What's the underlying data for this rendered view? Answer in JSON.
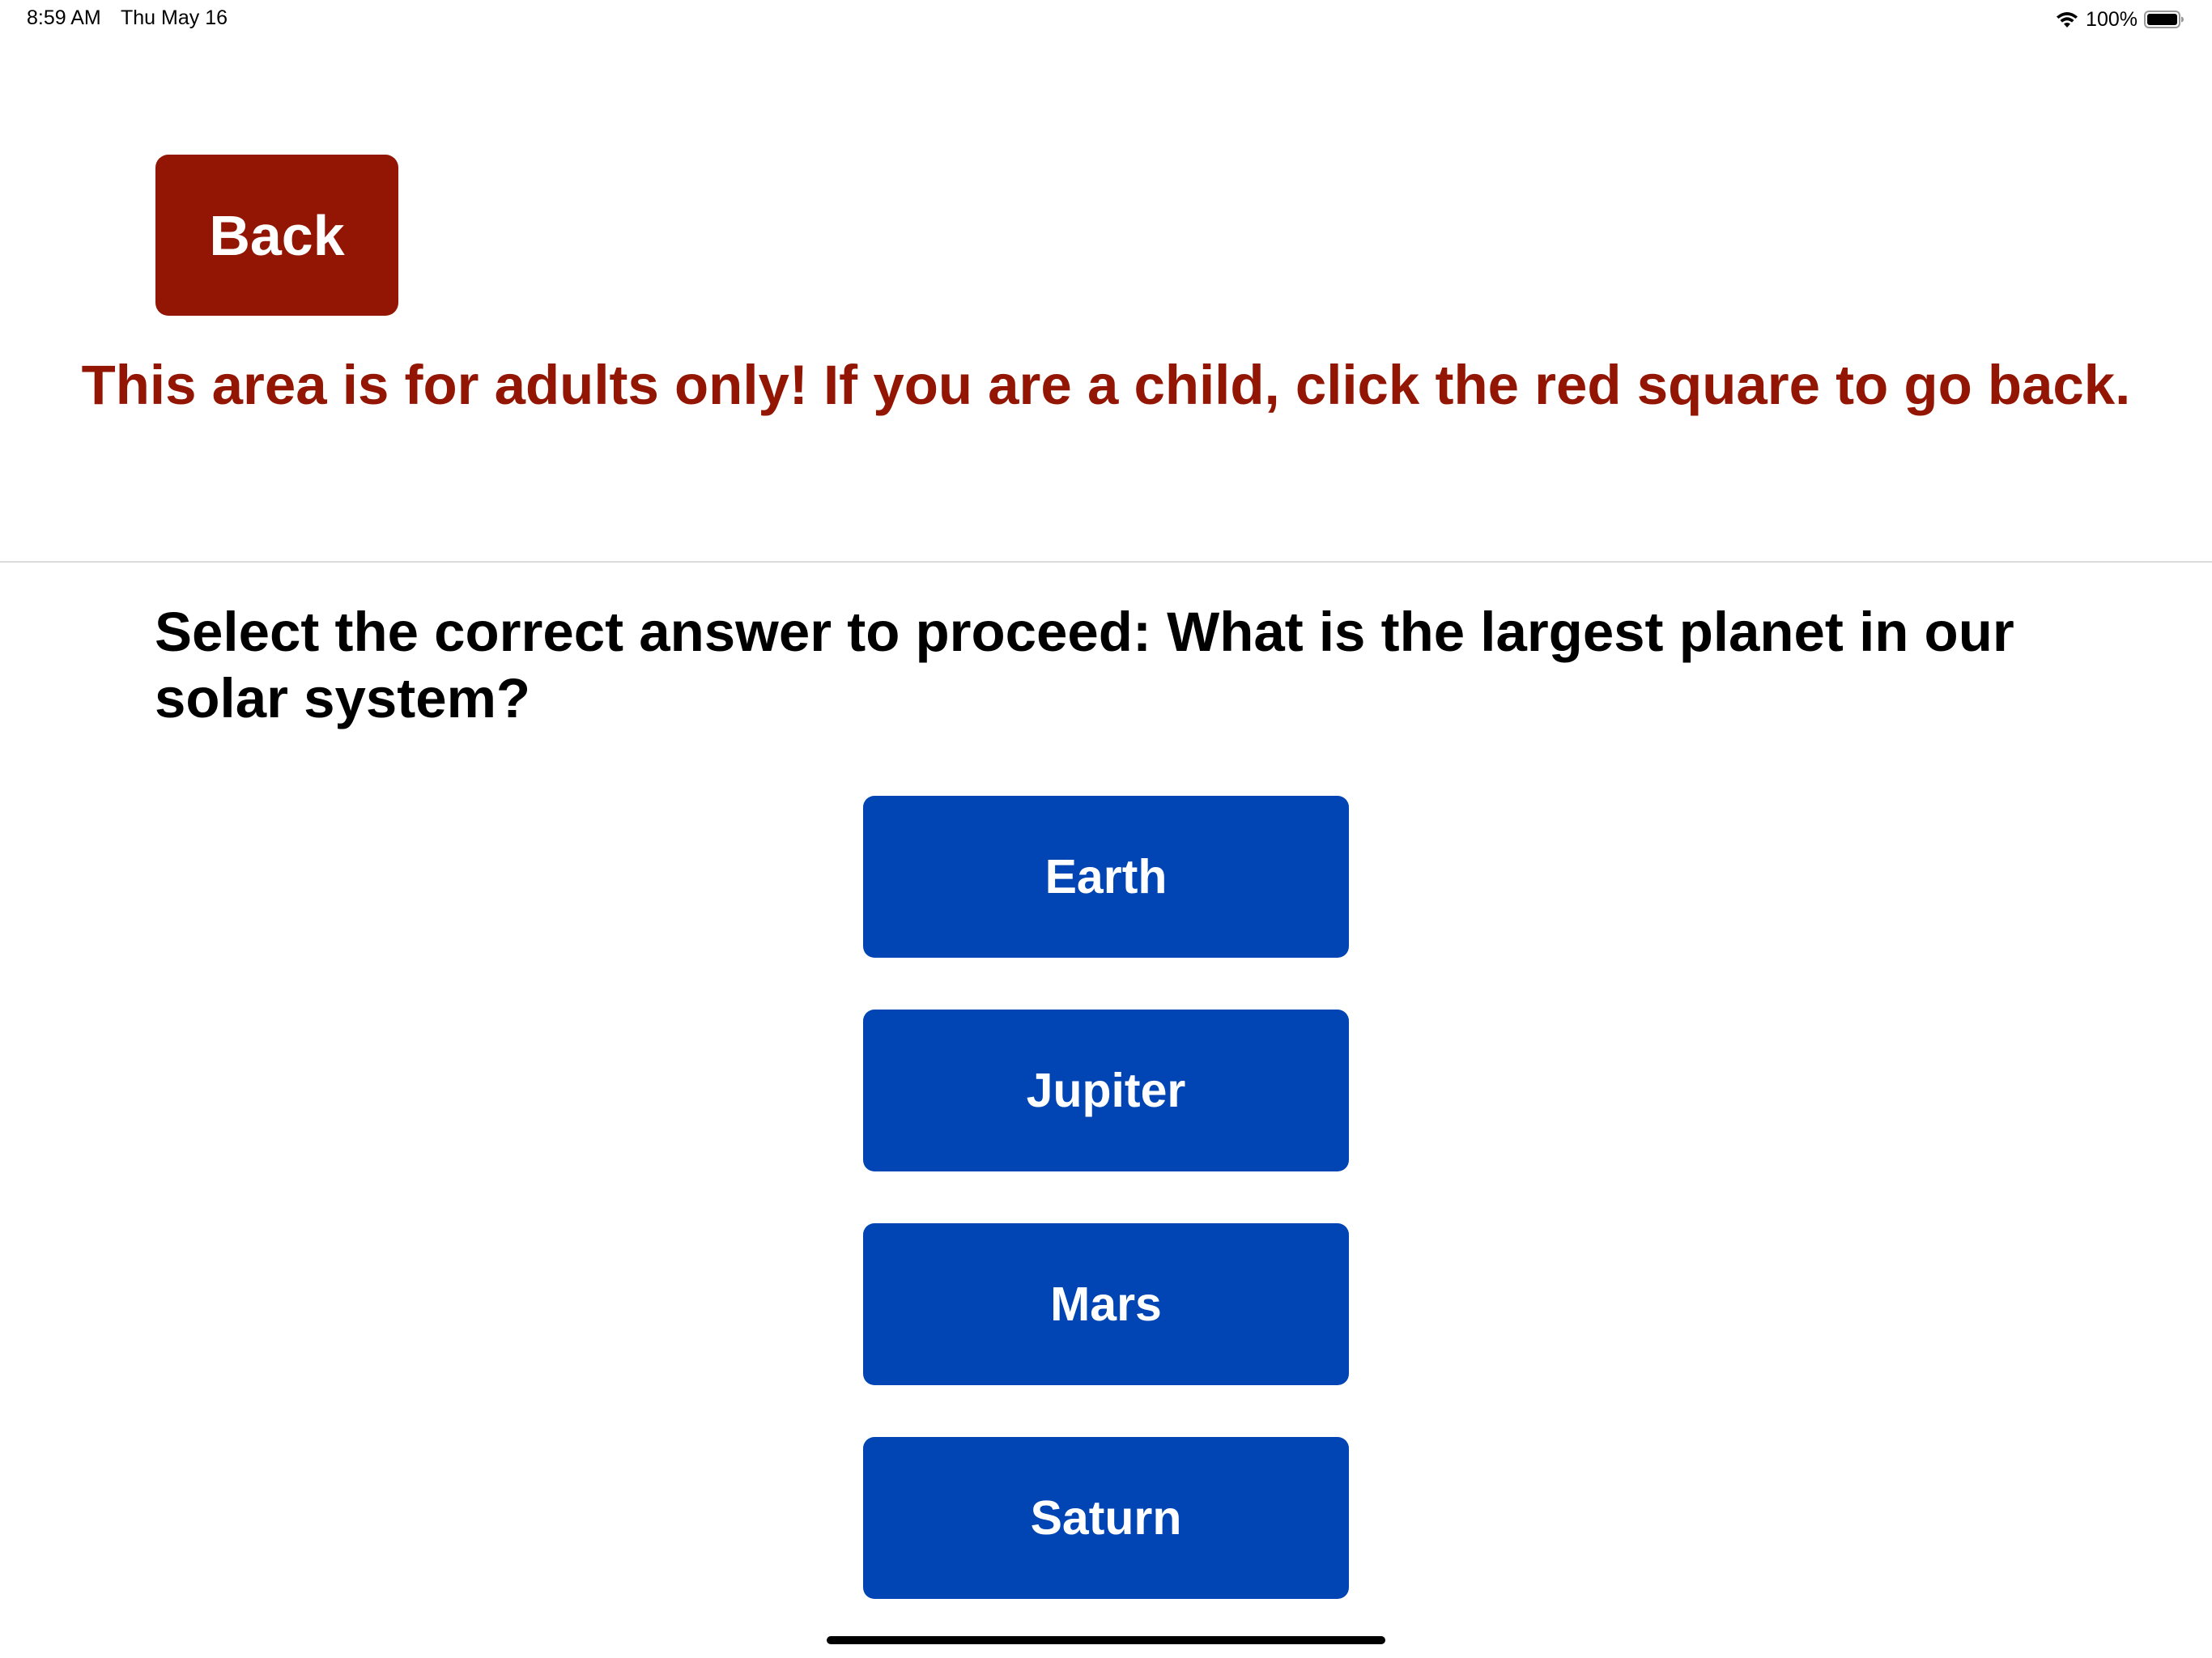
{
  "status_bar": {
    "time": "8:59 AM",
    "date": "Thu May 16",
    "battery_percent": "100%",
    "icons": [
      "wifi-icon",
      "battery-icon"
    ]
  },
  "back_button": {
    "label": "Back"
  },
  "warning": "This area is for adults only! If you are a child, click the red square to go back.",
  "question": "Select the correct answer to proceed: What is the largest planet in our solar system?",
  "answers": [
    "Earth",
    "Jupiter",
    "Mars",
    "Saturn"
  ],
  "colors": {
    "back_button": "#931604",
    "warning_text": "#931604",
    "answer_button": "#0045b3",
    "answer_text": "#ffffff",
    "background": "#ffffff"
  }
}
